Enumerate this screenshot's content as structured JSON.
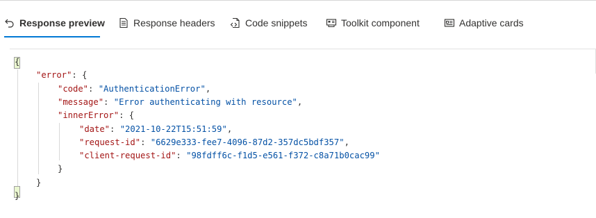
{
  "tabs": [
    {
      "label": "Response preview",
      "icon": "undo-arrow-icon",
      "active": true
    },
    {
      "label": "Response headers",
      "icon": "document-list-icon",
      "active": false
    },
    {
      "label": "Code snippets",
      "icon": "code-document-icon",
      "active": false
    },
    {
      "label": "Toolkit component",
      "icon": "component-icon",
      "active": false
    },
    {
      "label": "Adaptive cards",
      "icon": "card-icon",
      "active": false
    }
  ],
  "accent_color": "#0078d4",
  "json_colors": {
    "key": "#a31515",
    "string": "#0451a5"
  },
  "response": {
    "open_brace": "{",
    "error_key": "\"error\"",
    "code_key": "\"code\"",
    "code_value": "\"AuthenticationError\"",
    "message_key": "\"message\"",
    "message_value": "\"Error authenticating with resource\"",
    "inner_key": "\"innerError\"",
    "date_key": "\"date\"",
    "date_value": "\"2021-10-22T15:51:59\"",
    "request_id_key": "\"request-id\"",
    "request_id_value": "\"6629e333-fee7-4096-87d2-357dc5bdf357\"",
    "client_request_id_key": "\"client-request-id\"",
    "client_request_id_value": "\"98fdff6c-f1d5-e561-f372-c8a71b0cac99\"",
    "close_brace": "}"
  }
}
